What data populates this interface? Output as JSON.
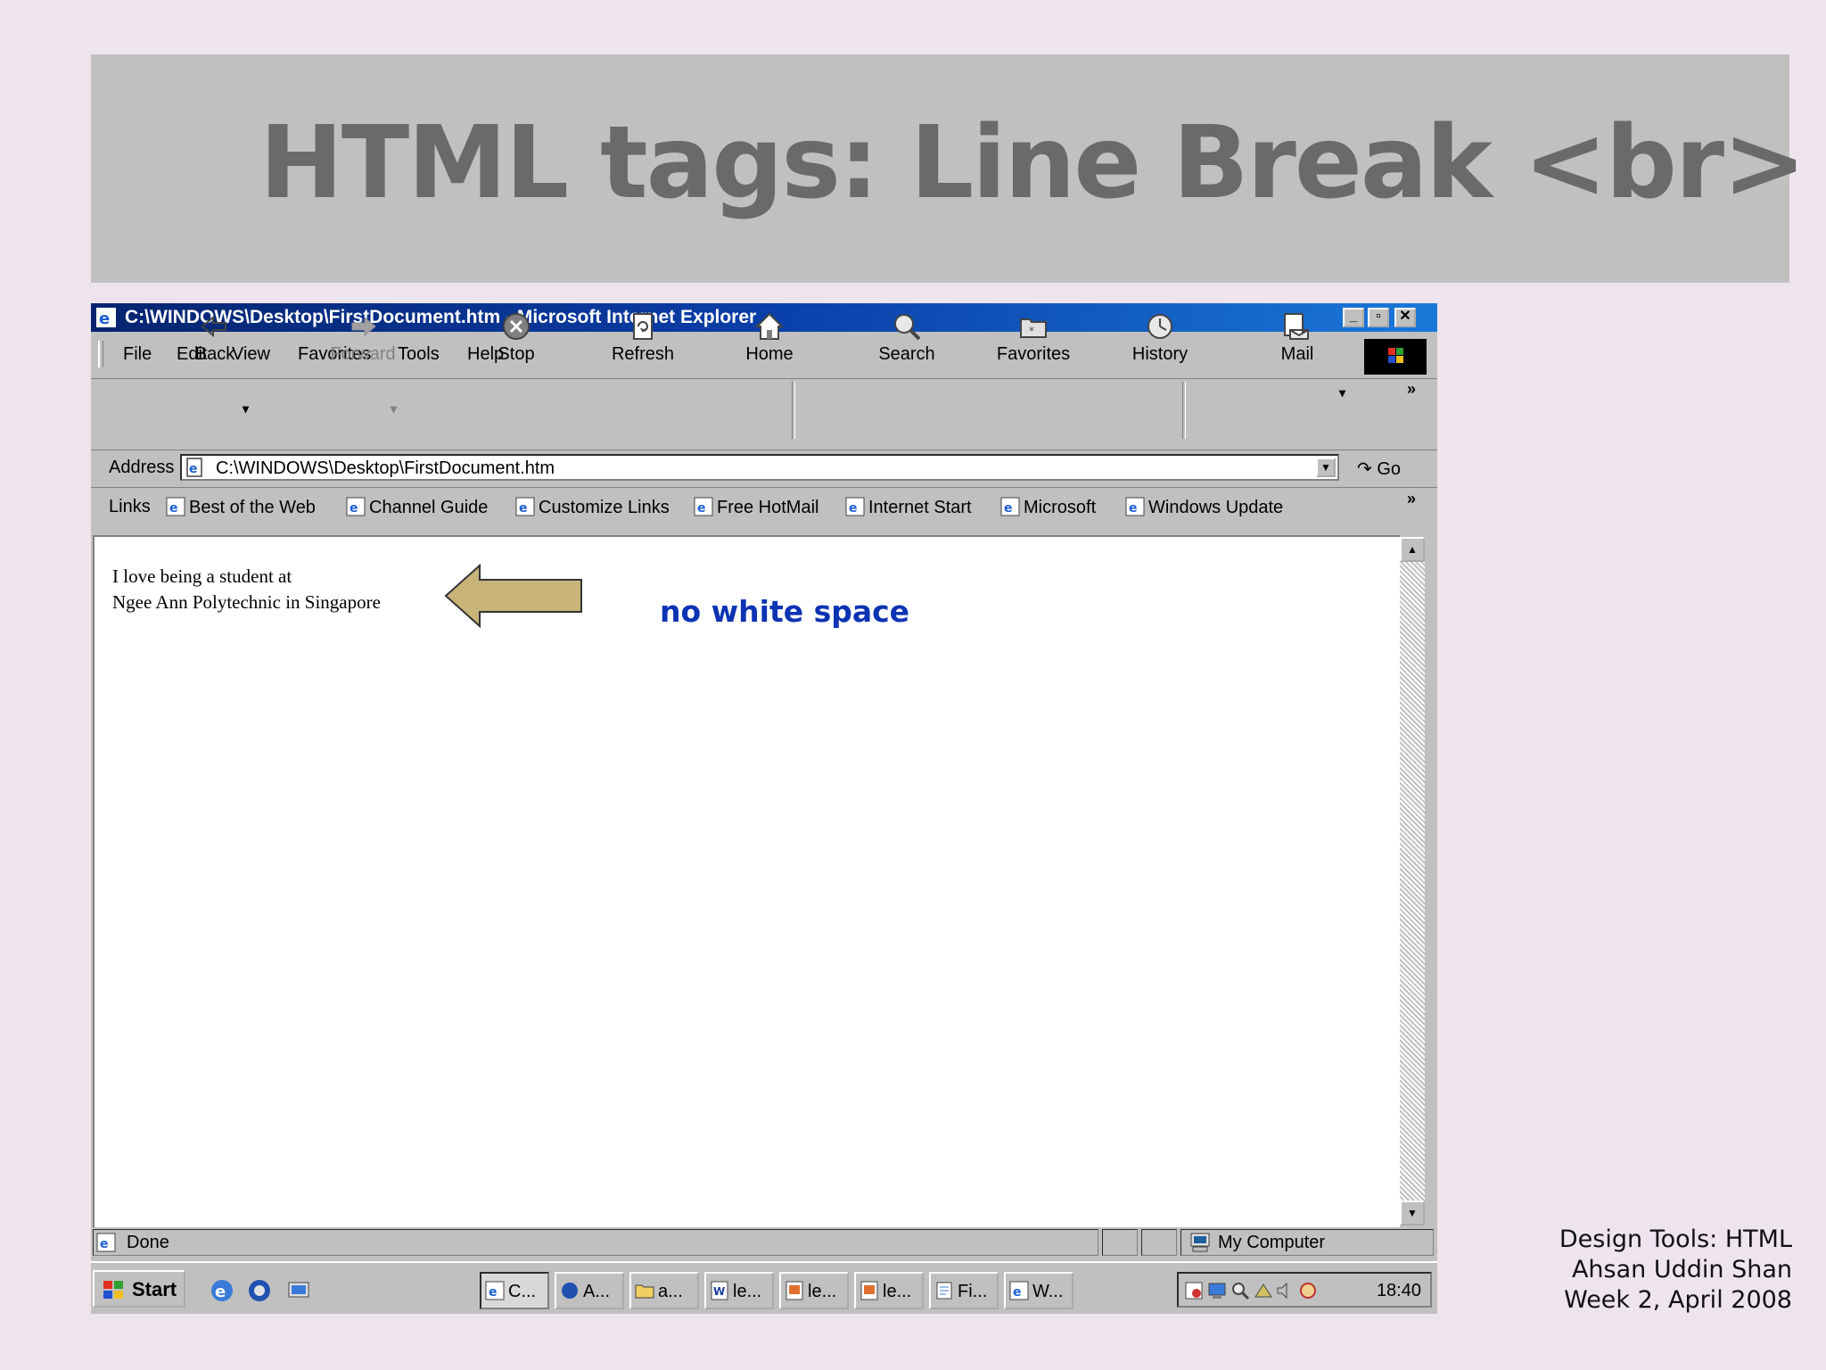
{
  "slide": {
    "title": "HTML tags: Line Break <br>",
    "footer": [
      "Design Tools: HTML",
      "Ahsan Uddin Shan",
      "Week 2, April 2008"
    ]
  },
  "window": {
    "title": "C:\\WINDOWS\\Desktop\\FirstDocument.htm - Microsoft Internet Explorer",
    "controls": [
      "minimize",
      "restore",
      "close"
    ]
  },
  "menu": [
    "File",
    "Edit",
    "View",
    "Favorites",
    "Tools",
    "Help"
  ],
  "toolbar": {
    "back": "Back",
    "forward": "Forward",
    "stop": "Stop",
    "refresh": "Refresh",
    "home": "Home",
    "search": "Search",
    "favorites": "Favorites",
    "history": "History",
    "mail": "Mail"
  },
  "address": {
    "label": "Address",
    "value": "C:\\WINDOWS\\Desktop\\FirstDocument.htm",
    "go": "Go"
  },
  "links": {
    "label": "Links",
    "items": [
      "Best of the Web",
      "Channel Guide",
      "Customize Links",
      "Free HotMail",
      "Internet Start",
      "Microsoft",
      "Windows Update"
    ]
  },
  "content": {
    "line1": "I love being a student at",
    "line2": "Ngee Ann Polytechnic in Singapore",
    "annotation": "no white space",
    "annotation_color": "#0b33b3",
    "arrow_color": "#c8b478"
  },
  "status": {
    "text": "Done",
    "zone": "My Computer"
  },
  "taskbar": {
    "start": "Start",
    "tasks": [
      "C...",
      "A...",
      "a...",
      "le...",
      "le...",
      "le...",
      "Fi...",
      "W..."
    ],
    "clock": "18:40"
  }
}
